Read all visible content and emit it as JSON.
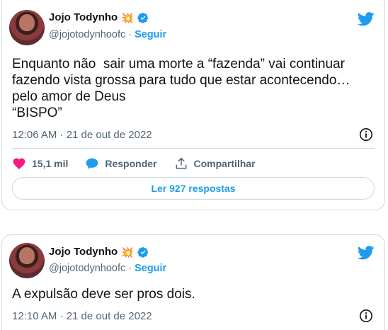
{
  "tweets": [
    {
      "author": {
        "name": "Jojo Todynho",
        "emoji": "💥",
        "handle": "@jojotodynhoofc",
        "separator": "·",
        "follow_label": "Seguir"
      },
      "text_lines": [
        "Enquanto não  sair uma morte a “fazenda” vai continuar",
        "fazendo vista grossa para tudo que estar acontecendo…",
        "pelo amor de Deus",
        "“BISPO”"
      ],
      "timestamp": "12:06 AM · 21 de out de 2022",
      "likes": "15,1 mil",
      "reply_label": "Responder",
      "share_label": "Compartilhar",
      "read_replies_label": "Ler 927 respostas"
    },
    {
      "author": {
        "name": "Jojo Todynho",
        "emoji": "💥",
        "handle": "@jojotodynhoofc",
        "separator": "·",
        "follow_label": "Seguir"
      },
      "text_lines": [
        "A expulsão deve ser pros dois."
      ],
      "timestamp": "12:10 AM · 21 de out de 2022"
    }
  ],
  "colors": {
    "accent": "#1d9bf0",
    "like": "#f91880",
    "text": "#0f1419",
    "muted": "#536471",
    "border": "#cfd9de"
  },
  "icons": [
    "twitter-bird-icon",
    "verified-badge-icon",
    "info-icon",
    "heart-icon",
    "reply-bubble-icon",
    "share-icon"
  ]
}
